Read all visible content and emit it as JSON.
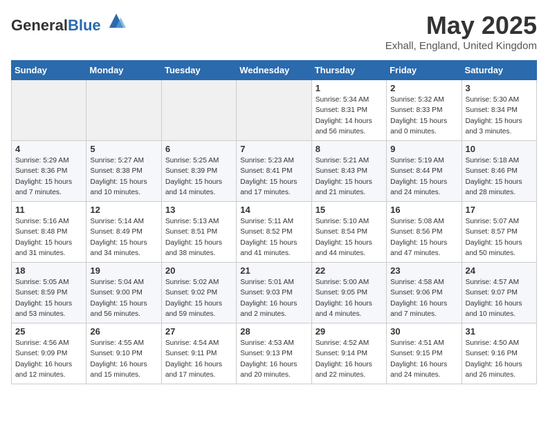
{
  "header": {
    "logo_general": "General",
    "logo_blue": "Blue",
    "month": "May 2025",
    "location": "Exhall, England, United Kingdom"
  },
  "days_of_week": [
    "Sunday",
    "Monday",
    "Tuesday",
    "Wednesday",
    "Thursday",
    "Friday",
    "Saturday"
  ],
  "weeks": [
    [
      {
        "day": "",
        "info": ""
      },
      {
        "day": "",
        "info": ""
      },
      {
        "day": "",
        "info": ""
      },
      {
        "day": "",
        "info": ""
      },
      {
        "day": "1",
        "info": "Sunrise: 5:34 AM\nSunset: 8:31 PM\nDaylight: 14 hours\nand 56 minutes."
      },
      {
        "day": "2",
        "info": "Sunrise: 5:32 AM\nSunset: 8:33 PM\nDaylight: 15 hours\nand 0 minutes."
      },
      {
        "day": "3",
        "info": "Sunrise: 5:30 AM\nSunset: 8:34 PM\nDaylight: 15 hours\nand 3 minutes."
      }
    ],
    [
      {
        "day": "4",
        "info": "Sunrise: 5:29 AM\nSunset: 8:36 PM\nDaylight: 15 hours\nand 7 minutes."
      },
      {
        "day": "5",
        "info": "Sunrise: 5:27 AM\nSunset: 8:38 PM\nDaylight: 15 hours\nand 10 minutes."
      },
      {
        "day": "6",
        "info": "Sunrise: 5:25 AM\nSunset: 8:39 PM\nDaylight: 15 hours\nand 14 minutes."
      },
      {
        "day": "7",
        "info": "Sunrise: 5:23 AM\nSunset: 8:41 PM\nDaylight: 15 hours\nand 17 minutes."
      },
      {
        "day": "8",
        "info": "Sunrise: 5:21 AM\nSunset: 8:43 PM\nDaylight: 15 hours\nand 21 minutes."
      },
      {
        "day": "9",
        "info": "Sunrise: 5:19 AM\nSunset: 8:44 PM\nDaylight: 15 hours\nand 24 minutes."
      },
      {
        "day": "10",
        "info": "Sunrise: 5:18 AM\nSunset: 8:46 PM\nDaylight: 15 hours\nand 28 minutes."
      }
    ],
    [
      {
        "day": "11",
        "info": "Sunrise: 5:16 AM\nSunset: 8:48 PM\nDaylight: 15 hours\nand 31 minutes."
      },
      {
        "day": "12",
        "info": "Sunrise: 5:14 AM\nSunset: 8:49 PM\nDaylight: 15 hours\nand 34 minutes."
      },
      {
        "day": "13",
        "info": "Sunrise: 5:13 AM\nSunset: 8:51 PM\nDaylight: 15 hours\nand 38 minutes."
      },
      {
        "day": "14",
        "info": "Sunrise: 5:11 AM\nSunset: 8:52 PM\nDaylight: 15 hours\nand 41 minutes."
      },
      {
        "day": "15",
        "info": "Sunrise: 5:10 AM\nSunset: 8:54 PM\nDaylight: 15 hours\nand 44 minutes."
      },
      {
        "day": "16",
        "info": "Sunrise: 5:08 AM\nSunset: 8:56 PM\nDaylight: 15 hours\nand 47 minutes."
      },
      {
        "day": "17",
        "info": "Sunrise: 5:07 AM\nSunset: 8:57 PM\nDaylight: 15 hours\nand 50 minutes."
      }
    ],
    [
      {
        "day": "18",
        "info": "Sunrise: 5:05 AM\nSunset: 8:59 PM\nDaylight: 15 hours\nand 53 minutes."
      },
      {
        "day": "19",
        "info": "Sunrise: 5:04 AM\nSunset: 9:00 PM\nDaylight: 15 hours\nand 56 minutes."
      },
      {
        "day": "20",
        "info": "Sunrise: 5:02 AM\nSunset: 9:02 PM\nDaylight: 15 hours\nand 59 minutes."
      },
      {
        "day": "21",
        "info": "Sunrise: 5:01 AM\nSunset: 9:03 PM\nDaylight: 16 hours\nand 2 minutes."
      },
      {
        "day": "22",
        "info": "Sunrise: 5:00 AM\nSunset: 9:05 PM\nDaylight: 16 hours\nand 4 minutes."
      },
      {
        "day": "23",
        "info": "Sunrise: 4:58 AM\nSunset: 9:06 PM\nDaylight: 16 hours\nand 7 minutes."
      },
      {
        "day": "24",
        "info": "Sunrise: 4:57 AM\nSunset: 9:07 PM\nDaylight: 16 hours\nand 10 minutes."
      }
    ],
    [
      {
        "day": "25",
        "info": "Sunrise: 4:56 AM\nSunset: 9:09 PM\nDaylight: 16 hours\nand 12 minutes."
      },
      {
        "day": "26",
        "info": "Sunrise: 4:55 AM\nSunset: 9:10 PM\nDaylight: 16 hours\nand 15 minutes."
      },
      {
        "day": "27",
        "info": "Sunrise: 4:54 AM\nSunset: 9:11 PM\nDaylight: 16 hours\nand 17 minutes."
      },
      {
        "day": "28",
        "info": "Sunrise: 4:53 AM\nSunset: 9:13 PM\nDaylight: 16 hours\nand 20 minutes."
      },
      {
        "day": "29",
        "info": "Sunrise: 4:52 AM\nSunset: 9:14 PM\nDaylight: 16 hours\nand 22 minutes."
      },
      {
        "day": "30",
        "info": "Sunrise: 4:51 AM\nSunset: 9:15 PM\nDaylight: 16 hours\nand 24 minutes."
      },
      {
        "day": "31",
        "info": "Sunrise: 4:50 AM\nSunset: 9:16 PM\nDaylight: 16 hours\nand 26 minutes."
      }
    ]
  ]
}
